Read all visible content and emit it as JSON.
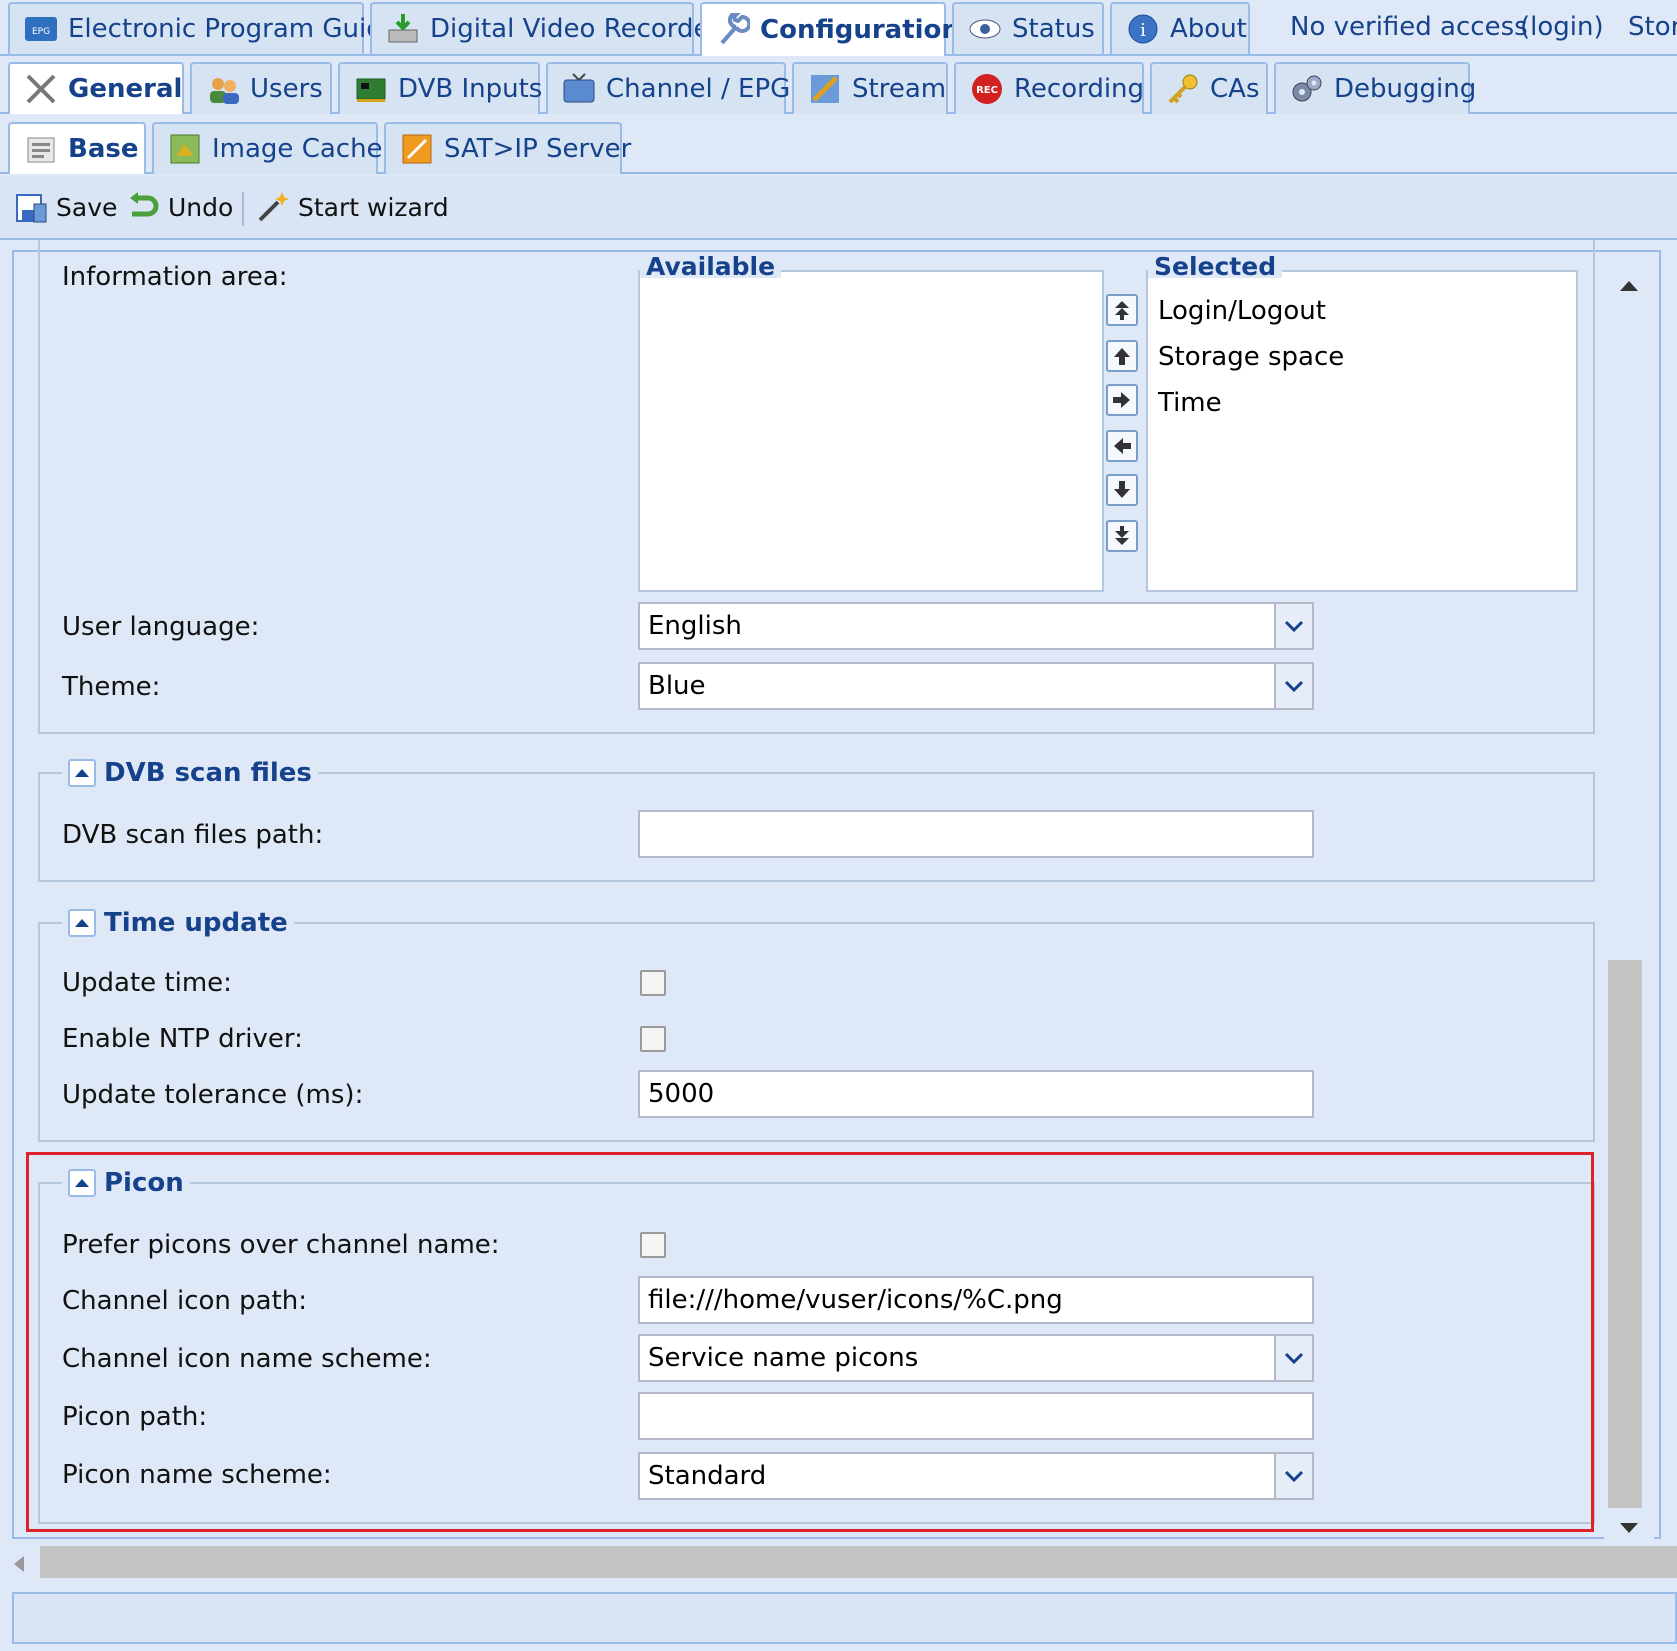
{
  "top_tabs": [
    {
      "label": "Electronic Program Guide",
      "icon": "epg-icon"
    },
    {
      "label": "Digital Video Recorder",
      "icon": "dvr-icon"
    },
    {
      "label": "Configuration",
      "icon": "wrench-icon"
    },
    {
      "label": "Status",
      "icon": "eye-icon"
    },
    {
      "label": "About",
      "icon": "info-icon"
    }
  ],
  "access": {
    "status": "No verified access",
    "login": "(login)",
    "storage": "Stora"
  },
  "second_tabs": [
    {
      "label": "General",
      "icon": "tools-icon"
    },
    {
      "label": "Users",
      "icon": "users-icon"
    },
    {
      "label": "DVB Inputs",
      "icon": "dvb-card-icon"
    },
    {
      "label": "Channel / EPG",
      "icon": "tv-icon"
    },
    {
      "label": "Stream",
      "icon": "stream-icon"
    },
    {
      "label": "Recording",
      "icon": "rec-icon"
    },
    {
      "label": "CAs",
      "icon": "key-icon"
    },
    {
      "label": "Debugging",
      "icon": "gears-icon"
    }
  ],
  "third_tabs": [
    {
      "label": "Base",
      "icon": "base-icon"
    },
    {
      "label": "Image Cache",
      "icon": "image-cache-icon"
    },
    {
      "label": "SAT>IP Server",
      "icon": "satip-icon"
    }
  ],
  "toolbar": {
    "save": "Save",
    "undo": "Undo",
    "wizard": "Start wizard"
  },
  "info_area": {
    "label": "Information area:",
    "available_title": "Available",
    "selected_title": "Selected",
    "selected_items": [
      "Login/Logout",
      "Storage space",
      "Time"
    ]
  },
  "user_language": {
    "label": "User language:",
    "value": "English"
  },
  "theme": {
    "label": "Theme:",
    "value": "Blue"
  },
  "dvb_scan": {
    "title": "DVB scan files",
    "path_label": "DVB scan files path:",
    "path_value": ""
  },
  "time_update": {
    "title": "Time update",
    "update_time_label": "Update time:",
    "ntp_label": "Enable NTP driver:",
    "tolerance_label": "Update tolerance (ms):",
    "tolerance_value": "5000"
  },
  "picon": {
    "title": "Picon",
    "prefer_label": "Prefer picons over channel name:",
    "icon_path_label": "Channel icon path:",
    "icon_path_value": "file:///home/vuser/icons/%C.png",
    "icon_scheme_label": "Channel icon name scheme:",
    "icon_scheme_value": "Service name picons",
    "picon_path_label": "Picon path:",
    "picon_path_value": "",
    "picon_scheme_label": "Picon name scheme:",
    "picon_scheme_value": "Standard"
  },
  "colors": {
    "highlight": "#e0202a",
    "accent": "#15428b",
    "background": "#dfe8f6"
  }
}
